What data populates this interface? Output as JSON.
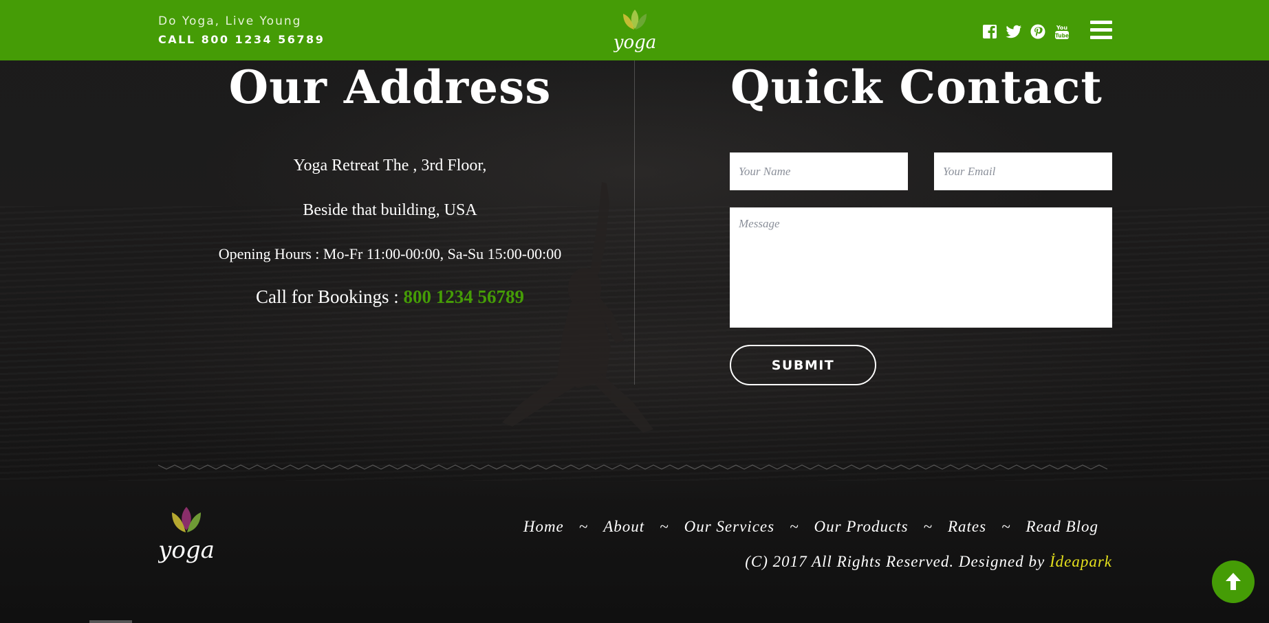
{
  "header": {
    "tagline": "Do Yoga, Live Young",
    "call": "CALL 800 1234 56789",
    "logo_text": "yoga",
    "social": [
      "facebook-icon",
      "twitter-icon",
      "pinterest-icon",
      "youtube-icon"
    ],
    "menu_icon": "hamburger-menu-icon"
  },
  "address": {
    "title": "Our Address",
    "line1": "Yoga Retreat The , 3rd Floor,",
    "line2": "Beside that building, USA",
    "hours": "Opening Hours : Mo-Fr 11:00-00:00, Sa-Su 15:00-00:00",
    "booking_label": "Call for Bookings : ",
    "booking_phone": "800 1234 56789"
  },
  "contact": {
    "title": "Quick Contact",
    "name_placeholder": "Your Name",
    "email_placeholder": "Your Email",
    "message_placeholder": "Message",
    "submit_label": "SUBMIT"
  },
  "footer": {
    "logo_text": "yoga",
    "nav": [
      "Home",
      "About",
      "Our Services",
      "Our Products",
      "Rates",
      "Read Blog"
    ],
    "separator": "~",
    "copyright_text": "(C) 2017 All Rights Reserved. Designed by ",
    "designer": "İdeapark"
  },
  "colors": {
    "brand_green": "#459c06",
    "designer_link": "#e5e01c"
  },
  "scroll_top_icon": "arrow-up-icon"
}
